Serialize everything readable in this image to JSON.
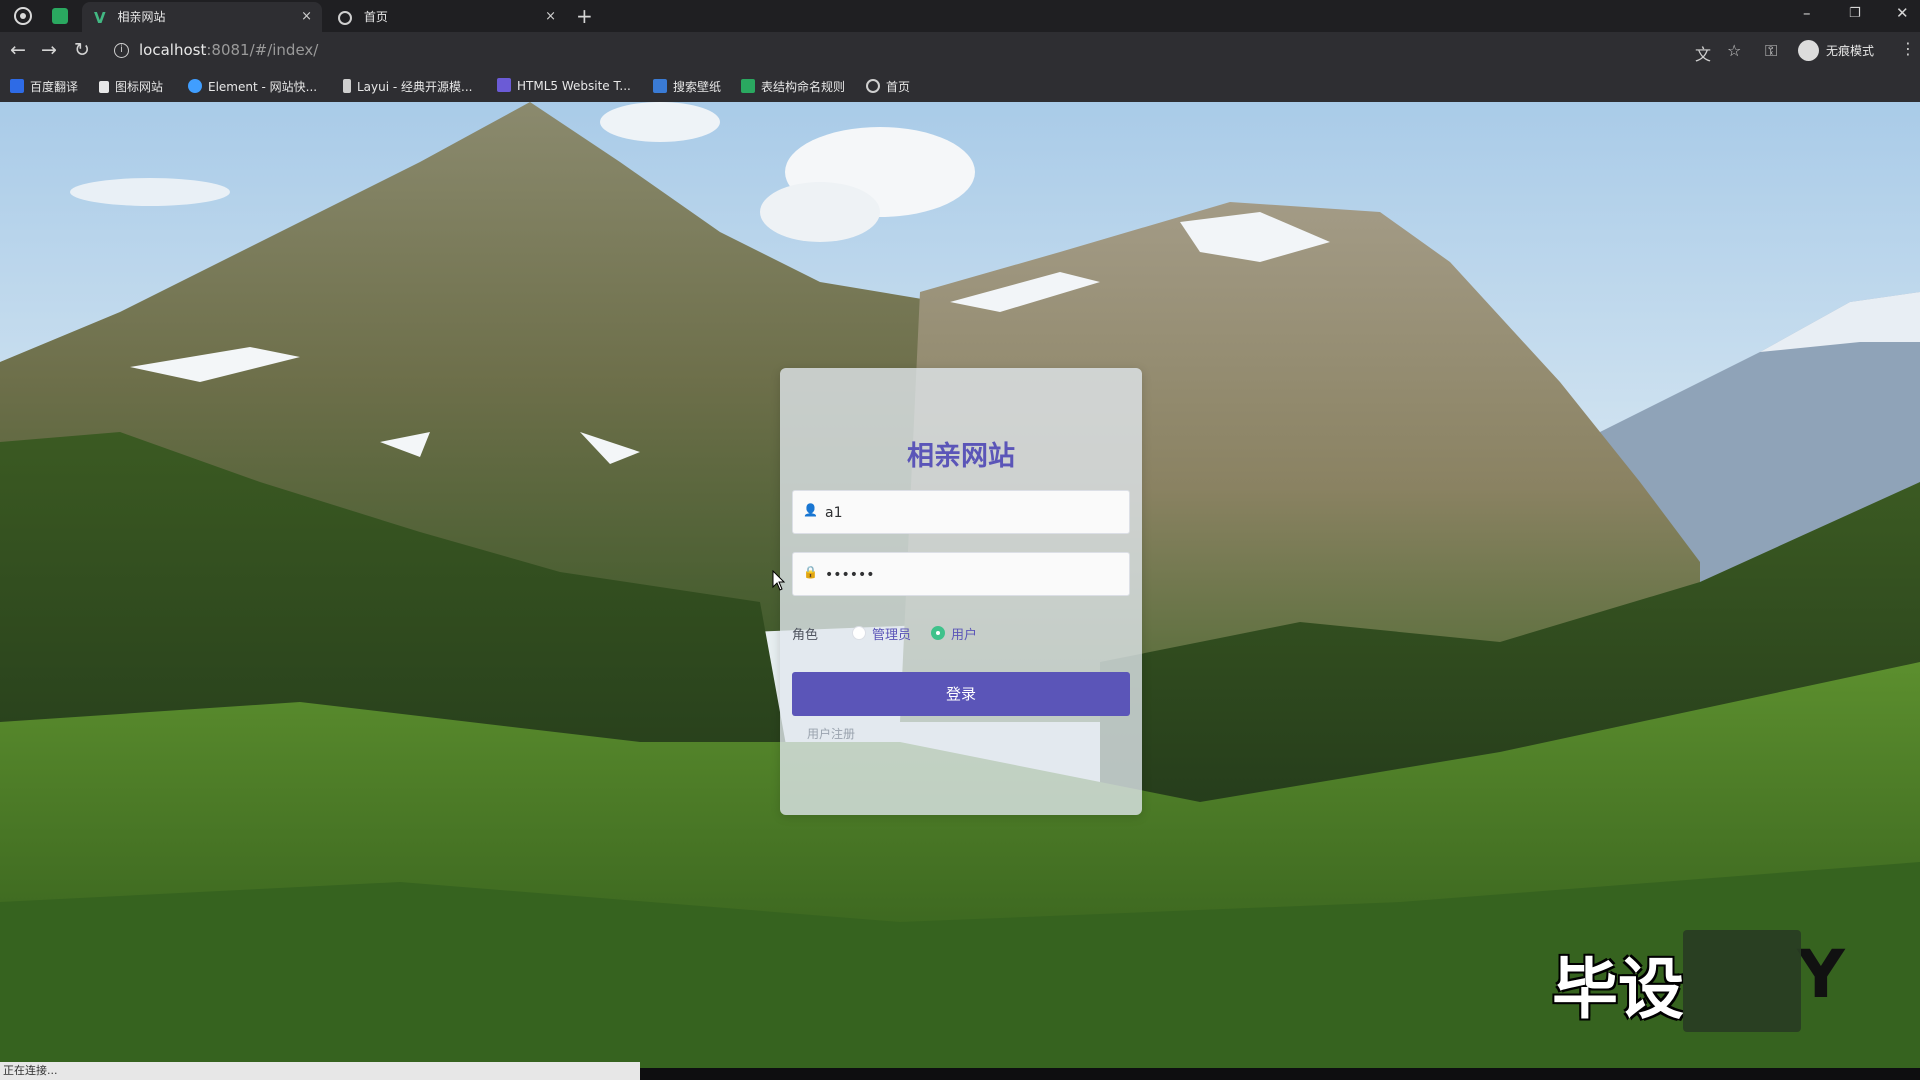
{
  "browser": {
    "tabs": [
      {
        "title": "相亲网站",
        "active": true,
        "favicon": "vue-icon"
      },
      {
        "title": "首页",
        "active": false,
        "favicon": "globe-icon"
      }
    ],
    "close_glyph": "×",
    "new_tab_glyph": "+",
    "url_host": "localhost",
    "url_rest": ":8081/#/index/",
    "profile_label": "无痕模式",
    "bookmarks": [
      {
        "label": "百度翻译",
        "icon": "baidu-translate-icon",
        "color": "#2e6be6"
      },
      {
        "label": "图标网站",
        "icon": "flag-icon",
        "color": "#e8e8e8"
      },
      {
        "label": "Element - 网站快...",
        "icon": "element-icon",
        "color": "#409eff"
      },
      {
        "label": "Layui - 经典开源模...",
        "icon": "layui-icon",
        "color": "#cfcfcf"
      },
      {
        "label": "HTML5 Website T...",
        "icon": "html5-icon",
        "color": "#6b5bd6"
      },
      {
        "label": "搜索壁纸",
        "icon": "wallpaper-icon",
        "color": "#3a7bd5"
      },
      {
        "label": "表结构命名规则",
        "icon": "sheet-icon",
        "color": "#2aa860"
      },
      {
        "label": "首页",
        "icon": "globe-icon",
        "color": "#cfcfcf"
      }
    ]
  },
  "login": {
    "title": "相亲网站",
    "username_value": "a1",
    "password_value": "123456",
    "role_label": "角色",
    "role_options": [
      {
        "label": "管理员",
        "selected": false
      },
      {
        "label": "用户",
        "selected": true
      }
    ],
    "login_button": "登录",
    "register_link": "用户注册"
  },
  "overlay": {
    "watermark": "毕设",
    "watermark_tail": "Y",
    "status_text": "正在连接..."
  },
  "colors": {
    "accent": "#5b55b8",
    "radio_selected": "#3fc28b",
    "title": "#5b55b8"
  }
}
